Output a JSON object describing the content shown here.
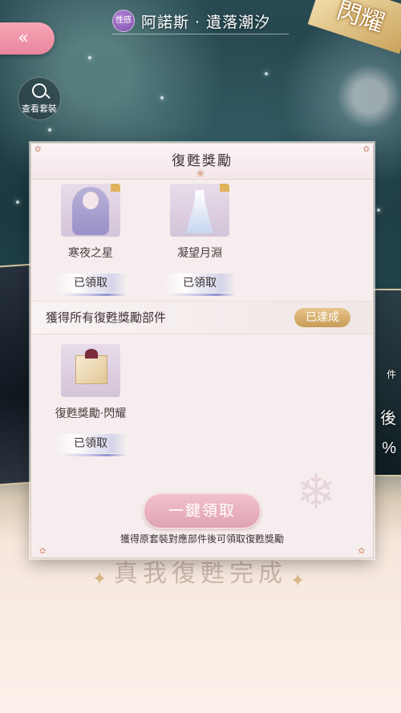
{
  "header": {
    "back_icon": "double-chevron-left",
    "badge_label": "性感",
    "title": "阿諾斯 · 遺落潮汐",
    "shine_banner": "閃耀"
  },
  "view_outfit": {
    "icon": "search-icon",
    "label": "查看套裝"
  },
  "background": {
    "caption": "真我復甦完成",
    "right_edge_text_1": "件",
    "right_edge_text_2": "後",
    "right_edge_text_3": "%"
  },
  "dialog": {
    "title": "復甦獎勵",
    "rewards": [
      {
        "name": "寒夜之星",
        "status": "已領取",
        "icon": "hair-icon"
      },
      {
        "name": "凝望月淵",
        "status": "已領取",
        "icon": "dress-icon"
      }
    ],
    "all_parts": {
      "title": "獲得所有復甦獎勵部件",
      "badge": "已達成",
      "reward": {
        "name": "復甦獎勵·閃耀",
        "status": "已領取",
        "icon": "gift-box-icon"
      }
    },
    "claim_all_label": "一鍵領取",
    "hint": "獲得原套裝對應部件後可領取復甦獎勵"
  },
  "colors": {
    "back_button": "#ef95a8",
    "claim_button": "#e8b3be",
    "achieved_badge": "#d8b070",
    "dialog_bg": "#f6eeee"
  }
}
